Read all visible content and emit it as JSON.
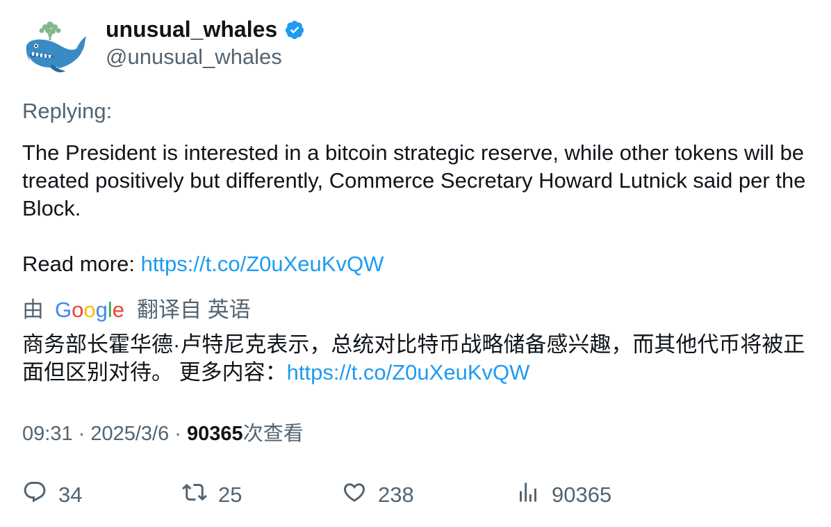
{
  "author": {
    "display_name": "unusual_whales",
    "handle": "@unusual_whales",
    "verified_icon": "verified-badge-icon",
    "avatar_icon": "whale-avatar"
  },
  "tweet": {
    "replying_label": "Replying:",
    "body": "The President is interested in a bitcoin strategic reserve, while other tokens will be treated positively but differently, Commerce Secretary Howard Lutnick said per the Block.",
    "read_more_label": "Read more: ",
    "link": "https://t.co/Z0uXeuKvQW"
  },
  "translation": {
    "by_label": "由",
    "google_letters": [
      "G",
      "o",
      "o",
      "g",
      "l",
      "e"
    ],
    "translated_from_label": "翻译自 英语",
    "text": "商务部长霍华德·卢特尼克表示，总统对比特币战略储备感兴趣，而其他代币将被正面但区别对待。 更多内容：",
    "link": "https://t.co/Z0uXeuKvQW"
  },
  "meta": {
    "time": "09:31",
    "separator": " · ",
    "date": "2025/3/6",
    "views_count": "90365",
    "views_label": "次查看"
  },
  "actions": {
    "replies": "34",
    "retweets": "25",
    "likes": "238",
    "views": "90365"
  },
  "colors": {
    "link": "#1d9bf0",
    "secondary_text": "#536471",
    "verified": "#1d9bf0"
  }
}
